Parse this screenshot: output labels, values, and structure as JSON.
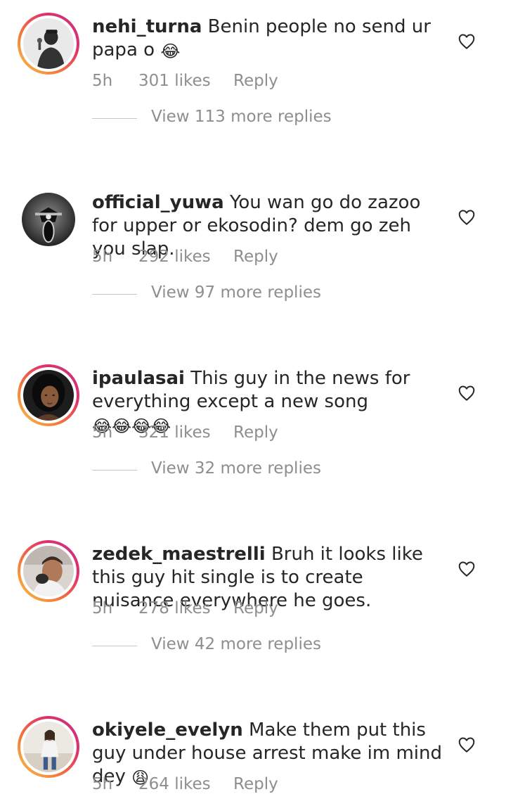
{
  "comments": [
    {
      "username": "nehi_turna",
      "text": "Benin people no send ur papa o",
      "emoji": "😂",
      "time": "5h",
      "likes": "301 likes",
      "reply_label": "Reply",
      "view_replies": "View 113 more replies",
      "avatar": "person-with-microphone-avatar",
      "story_ring": true
    },
    {
      "username": "official_yuwa",
      "text": "You wan go do zazoo for upper or ekosodin? dem go zeh you slap.",
      "emoji": "",
      "time": "5h",
      "likes": "292 likes",
      "reply_label": "Reply",
      "view_replies": "View 97 more replies",
      "avatar": "motorcycle-avatar",
      "story_ring": false
    },
    {
      "username": "ipaulasai",
      "text": "This guy in the news for everything except a new song",
      "emoji": "😂😂😂😂",
      "time": "5h",
      "likes": "321 likes",
      "reply_label": "Reply",
      "view_replies": "View 32 more replies",
      "avatar": "woman-portrait-avatar",
      "story_ring": true
    },
    {
      "username": "zedek_maestrelli",
      "text": "Bruh it looks like this guy hit single is to create nuisance everywhere he goes.",
      "emoji": "",
      "time": "5h",
      "likes": "278 likes",
      "reply_label": "Reply",
      "view_replies": "View 42 more replies",
      "avatar": "man-portrait-avatar",
      "story_ring": true
    },
    {
      "username": "okiyele_evelyn",
      "text": "Make them put this guy under house arrest make im mind dey",
      "emoji": "😩",
      "time": "5h",
      "likes": "264 likes",
      "reply_label": "Reply",
      "view_replies": "",
      "avatar": "woman-standing-avatar",
      "story_ring": true
    }
  ],
  "colors": {
    "text": "#262626",
    "secondary": "#8e8e8e",
    "divider": "#c7c7c7",
    "story_ring_start": "#f9c64a",
    "story_ring_end": "#c13584"
  }
}
